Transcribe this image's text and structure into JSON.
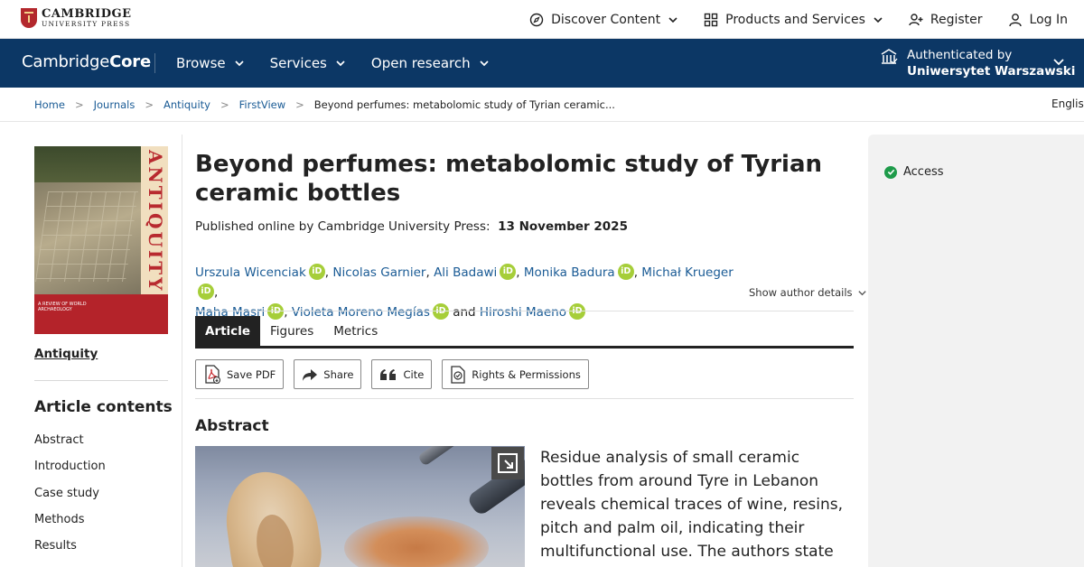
{
  "topbar": {
    "logo_line1": "CAMBRIDGE",
    "logo_line2": "UNIVERSITY PRESS",
    "discover_label": "Discover Content",
    "products_label": "Products and Services",
    "register_label": "Register",
    "login_label": "Log In"
  },
  "header": {
    "logo_cambridge": "Cambridge",
    "logo_core": "Core",
    "nav": [
      "Browse",
      "Services",
      "Open research"
    ],
    "auth_label": "Authenticated by",
    "auth_org": "Uniwersytet Warszawski"
  },
  "breadcrumb": {
    "items": [
      "Home",
      "Journals",
      "Antiquity",
      "FirstView"
    ],
    "current": "Beyond perfumes: metabolomic study of Tyrian ceramic...",
    "separator": ">",
    "language": "English"
  },
  "sidebar": {
    "cover_title": "ANTIQUITY",
    "cover_tagline": "A REVIEW OF WORLD ARCHAEOLOGY",
    "journal_link": "Antiquity",
    "contents_title": "Article contents",
    "contents": [
      "Abstract",
      "Introduction",
      "Case study",
      "Methods",
      "Results"
    ]
  },
  "article": {
    "title": "Beyond perfumes: metabolomic study of Tyrian ceramic bottles",
    "published_prefix": "Published online by Cambridge University Press:",
    "published_date": "13 November 2025",
    "authors": [
      "Urszula Wicenciak",
      "Nicolas Garnier",
      "Ali Badawi",
      "Monika Badura",
      "Michał Krueger",
      "Maha Masri",
      "Violeta Moreno Megías",
      "Hiroshi Maeno"
    ],
    "author_separator": ",",
    "and_word": "and",
    "orcid_label": "iD",
    "show_details": "Show author details",
    "tabs": [
      "Article",
      "Figures",
      "Metrics"
    ],
    "actions": {
      "save_pdf": "Save PDF",
      "share": "Share",
      "cite": "Cite",
      "rights": "Rights & Permissions"
    },
    "abstract_heading": "Abstract",
    "abstract_text": "Residue analysis of small ceramic bottles from around Tyre in Lebanon reveals chemical traces of wine, resins, pitch and palm oil, indicating their multifunctional use. The authors state that these results enhance"
  },
  "access_panel": {
    "access_label": "Access"
  },
  "colors": {
    "header_bg": "#0c3765",
    "link": "#1a5b95",
    "orcid": "#a6ce39",
    "access_check": "#1e9b4a"
  }
}
